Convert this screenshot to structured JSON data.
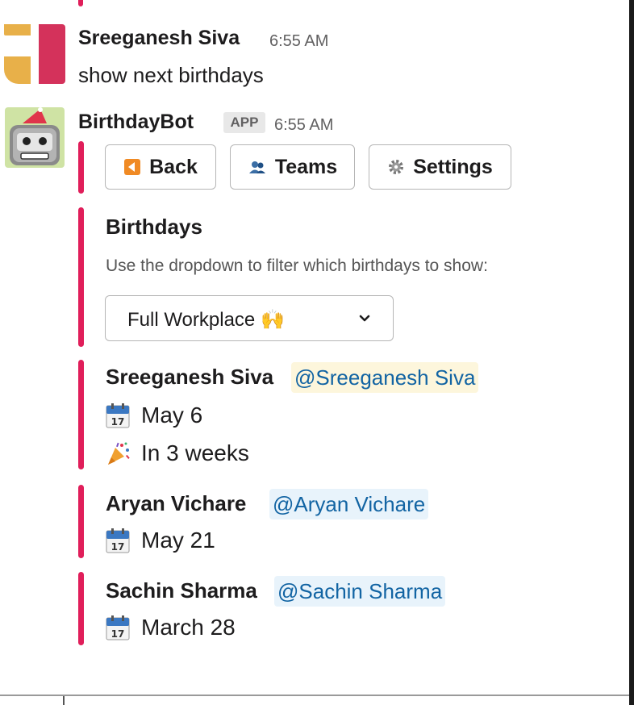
{
  "messages": [
    {
      "author": "Sreeganesh Siva",
      "time": "6:55 AM",
      "text": "show next birthdays"
    },
    {
      "author": "BirthdayBot",
      "badge": "APP",
      "time": "6:55 AM"
    }
  ],
  "buttons": [
    {
      "label": "Back",
      "icon": "back-arrow-icon"
    },
    {
      "label": "Teams",
      "icon": "people-icon"
    },
    {
      "label": "Settings",
      "icon": "gear-icon"
    }
  ],
  "section": {
    "title": "Birthdays",
    "subtitle": "Use the dropdown to filter which birthdays to show:"
  },
  "dropdown": {
    "selected": "Full Workplace 🙌",
    "icon": "chevron-down-icon"
  },
  "birthdays": [
    {
      "name": "Sreeganesh Siva",
      "mention": "@Sreeganesh Siva",
      "date": "May 6",
      "relative": "In 3 weeks"
    },
    {
      "name": "Aryan Vichare",
      "mention": "@Aryan Vichare",
      "date": "May 21"
    },
    {
      "name": "Sachin Sharma",
      "mention": "@Sachin Sharma",
      "date": "March 28"
    }
  ],
  "colors": {
    "accent": "#e01e5a",
    "mention_text": "#1264a3",
    "self_mention_bg": "#fdf6dc",
    "mention_bg": "#e8f3fb"
  }
}
